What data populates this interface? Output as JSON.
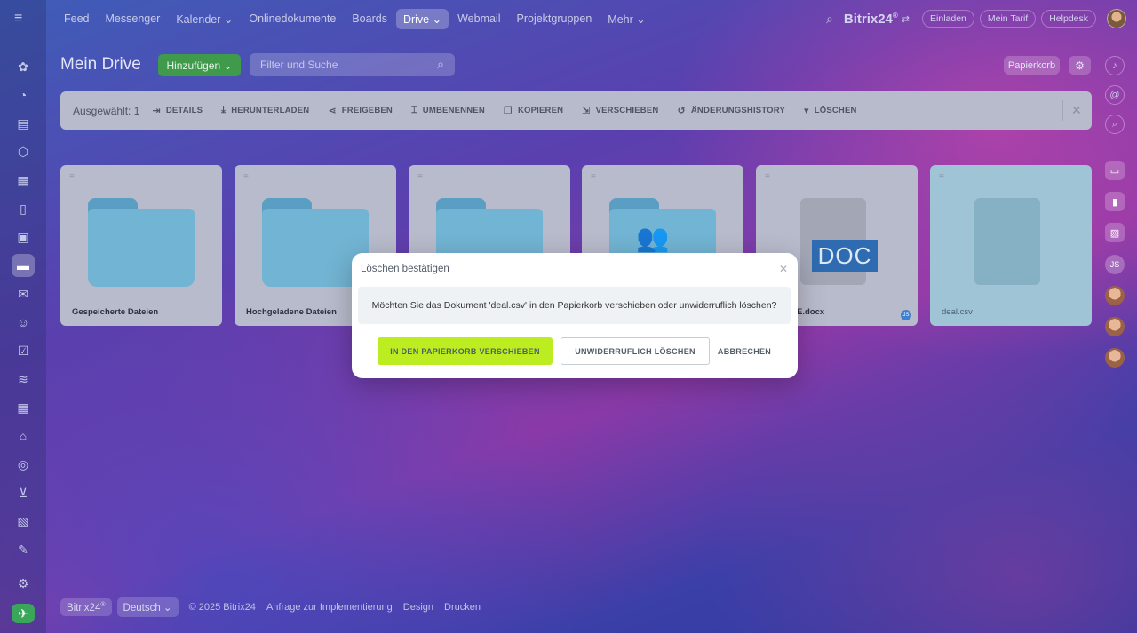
{
  "nav": {
    "items": [
      "Feed",
      "Messenger",
      "Kalender",
      "Onlinedokumente",
      "Boards",
      "Drive",
      "Webmail",
      "Projektgruppen",
      "Mehr"
    ],
    "active": "Drive"
  },
  "topright": {
    "logo": "Bitrix24",
    "logo_mark": "®",
    "buttons": [
      "Einladen",
      "Mein Tarif",
      "Helpdesk"
    ]
  },
  "header": {
    "title": "Mein Drive",
    "add_label": "Hinzufügen",
    "search_placeholder": "Filter und Suche",
    "trash_label": "Papierkorb"
  },
  "actionbar": {
    "selected": "Ausgewählt: 1",
    "actions": [
      {
        "label": "DETAILS",
        "icon": "details-icon"
      },
      {
        "label": "HERUNTERLADEN",
        "icon": "download-icon"
      },
      {
        "label": "FREIGEBEN",
        "icon": "share-icon"
      },
      {
        "label": "UMBENENNEN",
        "icon": "rename-icon"
      },
      {
        "label": "KOPIEREN",
        "icon": "copy-icon"
      },
      {
        "label": "VERSCHIEBEN",
        "icon": "move-icon"
      },
      {
        "label": "ÄNDERUNGSHISTORY",
        "icon": "history-icon"
      },
      {
        "label": "LÖSCHEN",
        "icon": "trash-icon"
      }
    ]
  },
  "tiles": [
    {
      "name": "Gespeicherte Dateien",
      "type": "folder"
    },
    {
      "name": "Hochgeladene Dateien",
      "type": "folder"
    },
    {
      "name": "",
      "type": "folder"
    },
    {
      "name": "",
      "type": "shared-folder"
    },
    {
      "name": "E.docx",
      "type": "doc",
      "doc_label": "DOC",
      "badge": "JS"
    },
    {
      "name": "deal.csv",
      "type": "csv",
      "selected": true
    }
  ],
  "footer": {
    "brand": "Bitrix24",
    "brand_mark": "®",
    "language": "Deutsch",
    "copyright": "© 2025 Bitrix24",
    "links": [
      "Anfrage zur Implementierung",
      "Design",
      "Drucken"
    ]
  },
  "modal": {
    "title": "Löschen bestätigen",
    "message": "Möchten Sie das Dokument 'deal.csv' in den Papierkorb verschieben oder unwiderruflich löschen?",
    "move_label": "IN DEN PAPIERKORB VERSCHIEBEN",
    "delete_label": "UNWIDERRUFLICH LÖSCHEN",
    "cancel_label": "ABBRECHEN"
  },
  "rail": {
    "initials": "JS"
  },
  "colors": {
    "accent_green": "#bbed21",
    "add_button": "#3f9a4c",
    "doc_blue": "#2f6bb0"
  }
}
